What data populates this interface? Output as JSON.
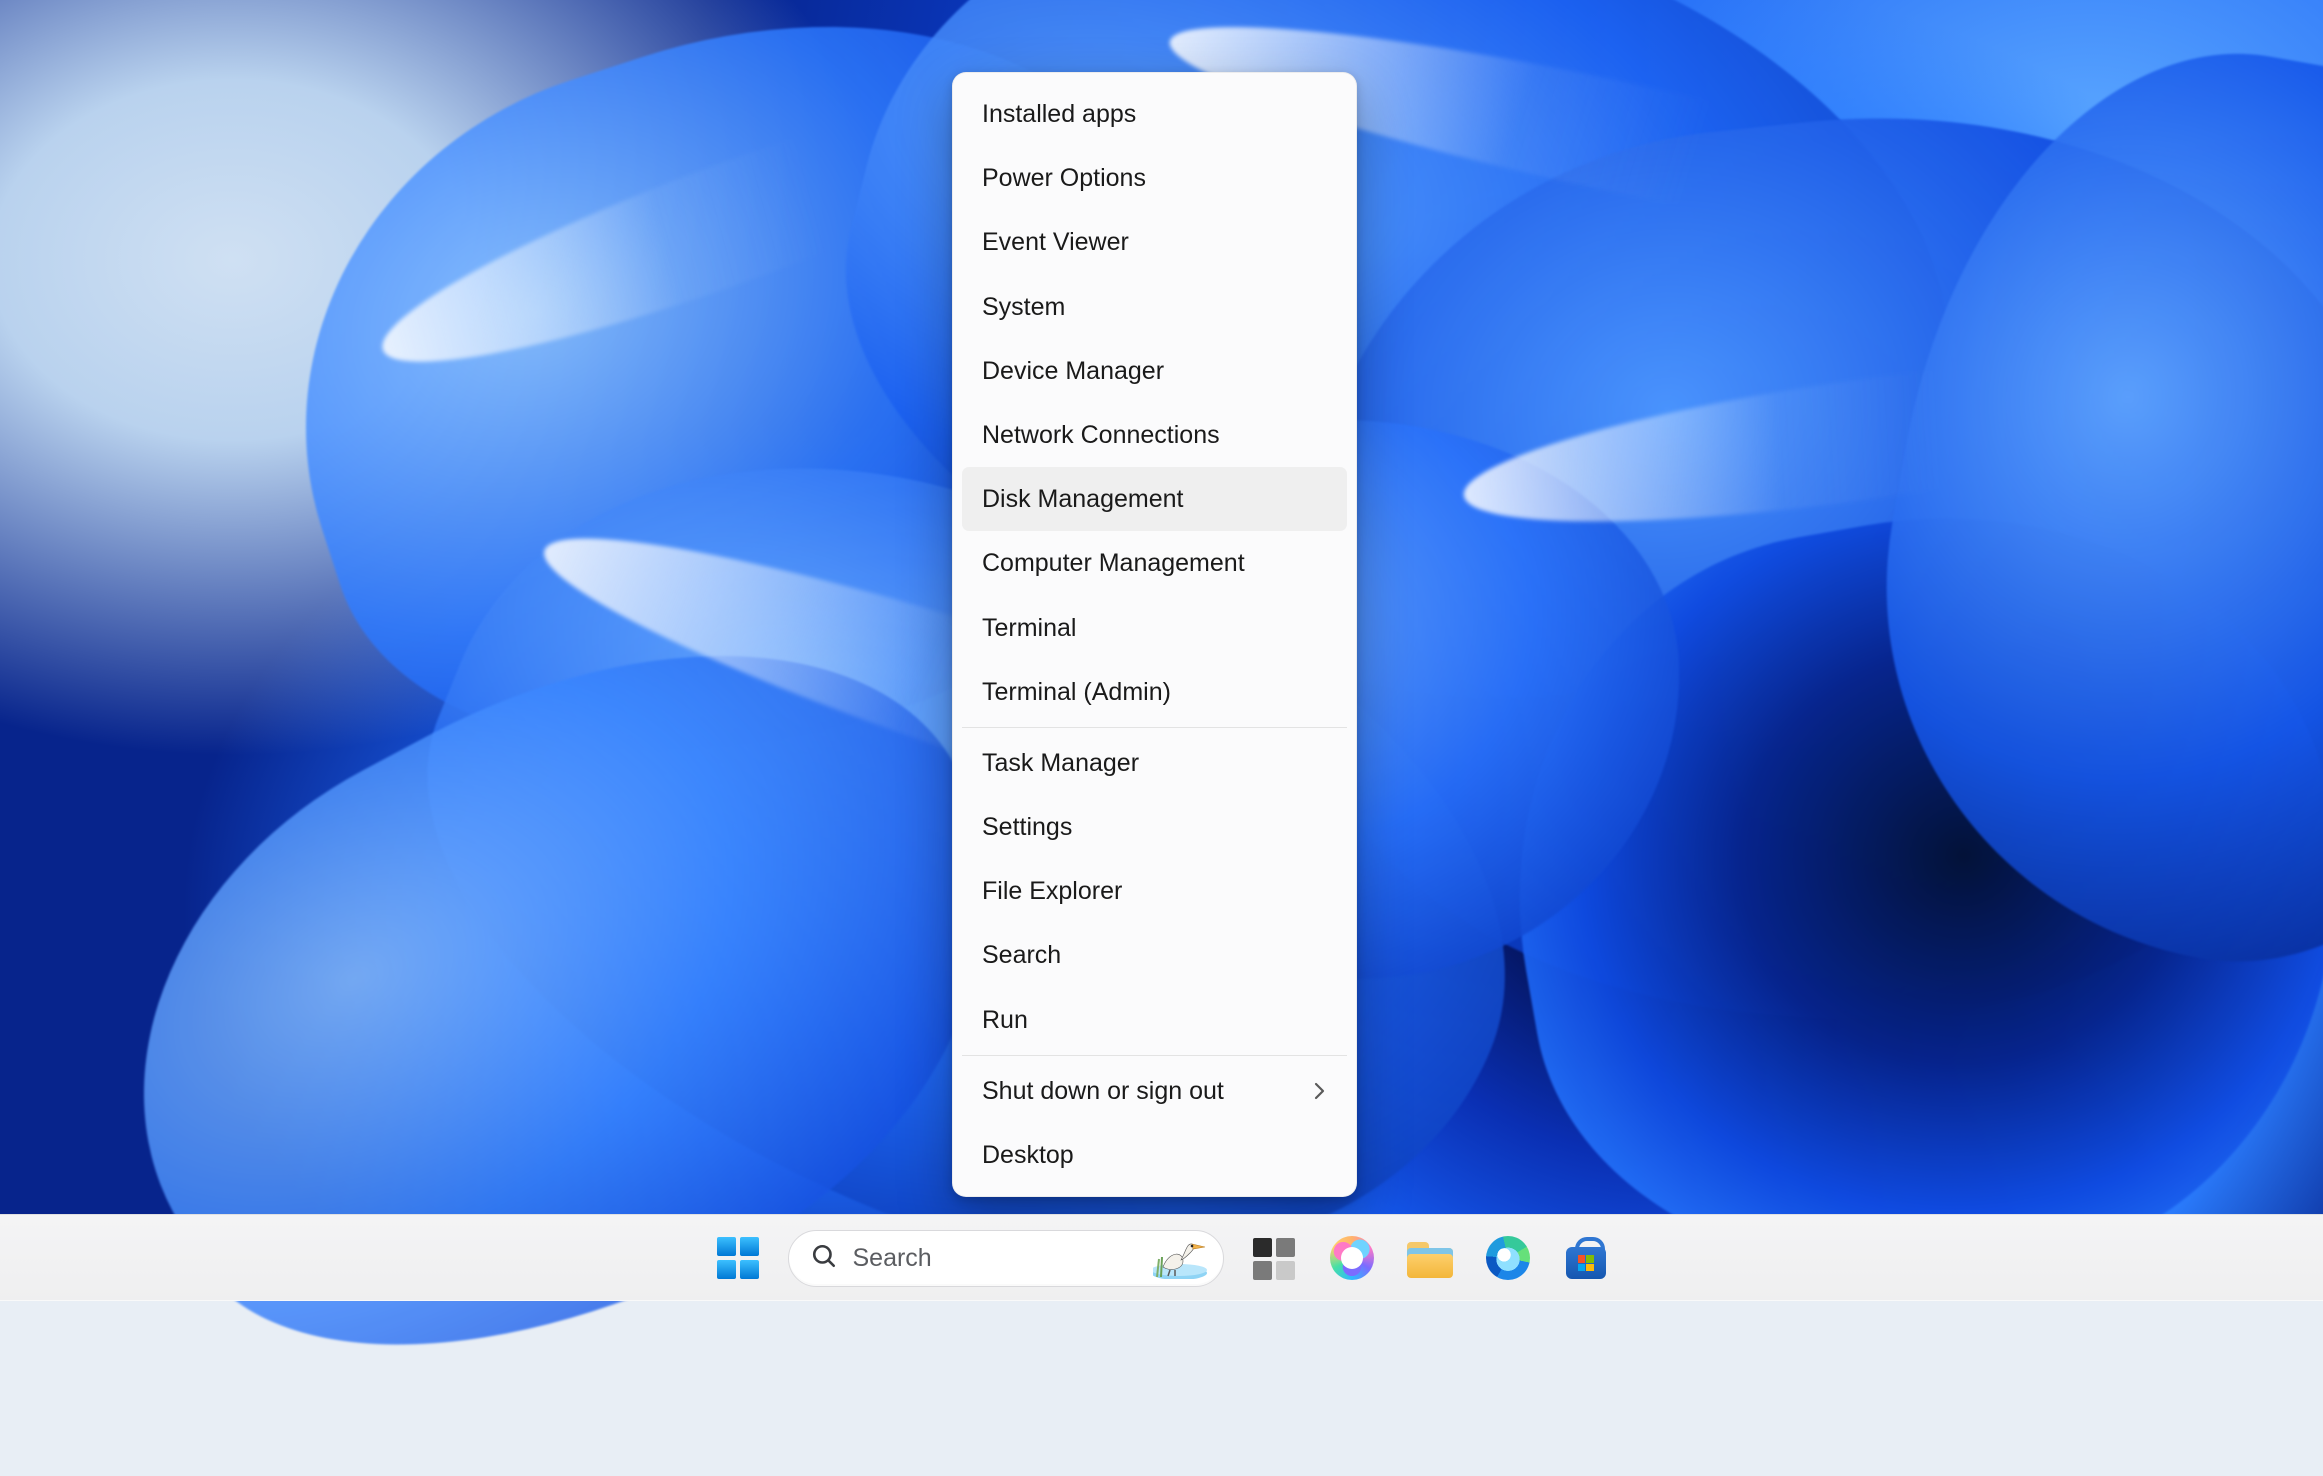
{
  "winx_menu": {
    "groups": [
      [
        {
          "id": "installed-apps",
          "label": "Installed apps"
        },
        {
          "id": "power-options",
          "label": "Power Options"
        },
        {
          "id": "event-viewer",
          "label": "Event Viewer"
        },
        {
          "id": "system",
          "label": "System"
        },
        {
          "id": "device-manager",
          "label": "Device Manager"
        },
        {
          "id": "network-connections",
          "label": "Network Connections"
        },
        {
          "id": "disk-management",
          "label": "Disk Management"
        },
        {
          "id": "computer-management",
          "label": "Computer Management"
        },
        {
          "id": "terminal",
          "label": "Terminal"
        },
        {
          "id": "terminal-admin",
          "label": "Terminal (Admin)"
        }
      ],
      [
        {
          "id": "task-manager",
          "label": "Task Manager"
        },
        {
          "id": "settings",
          "label": "Settings"
        },
        {
          "id": "file-explorer",
          "label": "File Explorer"
        },
        {
          "id": "search",
          "label": "Search"
        },
        {
          "id": "run",
          "label": "Run"
        }
      ],
      [
        {
          "id": "shut-down-sign-out",
          "label": "Shut down or sign out",
          "submenu": true
        },
        {
          "id": "desktop",
          "label": "Desktop"
        }
      ]
    ],
    "highlighted_id": "disk-management"
  },
  "taskbar": {
    "search_placeholder": "Search",
    "items": [
      {
        "id": "start",
        "name": "Start"
      },
      {
        "id": "search",
        "name": "Search"
      },
      {
        "id": "task-view",
        "name": "Task View"
      },
      {
        "id": "copilot",
        "name": "Copilot"
      },
      {
        "id": "file-explorer",
        "name": "File Explorer"
      },
      {
        "id": "edge",
        "name": "Microsoft Edge"
      },
      {
        "id": "store",
        "name": "Microsoft Store"
      }
    ]
  }
}
